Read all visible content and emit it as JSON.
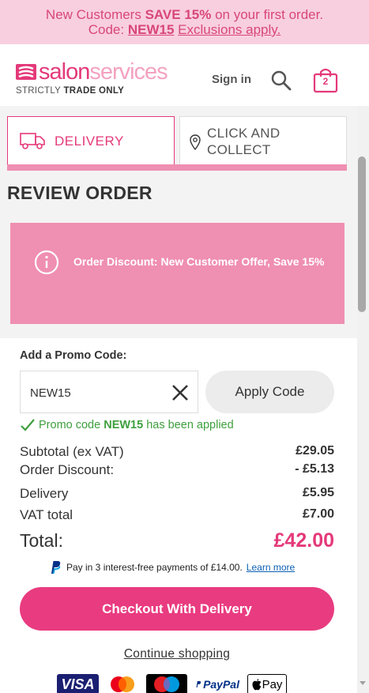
{
  "promo_banner": {
    "line1_pre": "New Customers ",
    "line1_bold": "SAVE 15%",
    "line1_post": " on your first order.",
    "line2_pre": "Code: ",
    "line2_code": "NEW15",
    "line2_link": "Exclusions apply."
  },
  "header": {
    "logo_part1": "salon",
    "logo_part2": "services",
    "tagline_pre": "STRICTLY ",
    "tagline_bold": "TRADE ONLY",
    "sign_in": "Sign in",
    "bag_count": "2"
  },
  "tabs": {
    "delivery": "DELIVERY",
    "collect": "CLICK AND COLLECT"
  },
  "review_title": "REVIEW ORDER",
  "notice": "Order Discount: New Customer Offer, Save 15%",
  "promo": {
    "label": "Add a Promo Code:",
    "value": "NEW15",
    "apply_label": "Apply Code",
    "applied_pre": "Promo code ",
    "applied_code": "NEW15",
    "applied_post": " has been applied"
  },
  "summary": {
    "subtotal_label": "Subtotal (ex VAT)",
    "subtotal_value": "£29.05",
    "discount_label": "Order Discount:",
    "discount_value": "- £5.13",
    "delivery_label": "Delivery",
    "delivery_value": "£5.95",
    "vat_label": "VAT total",
    "vat_value": "£7.00",
    "total_label": "Total:",
    "total_value": "£42.00"
  },
  "paypal": {
    "text": "Pay in 3 interest-free payments of £14.00.",
    "learn_more": "Learn more"
  },
  "checkout_label": "Checkout With Delivery",
  "continue_label": "Continue shopping",
  "payment_logos": {
    "visa": "VISA",
    "paypal": "PayPal",
    "apple_pay": "Pay"
  },
  "colors": {
    "brand_pink": "#e4397a",
    "banner_bg": "#f8cfde",
    "notice_bg": "#ef8fb1",
    "success_green": "#3e9f3e"
  }
}
